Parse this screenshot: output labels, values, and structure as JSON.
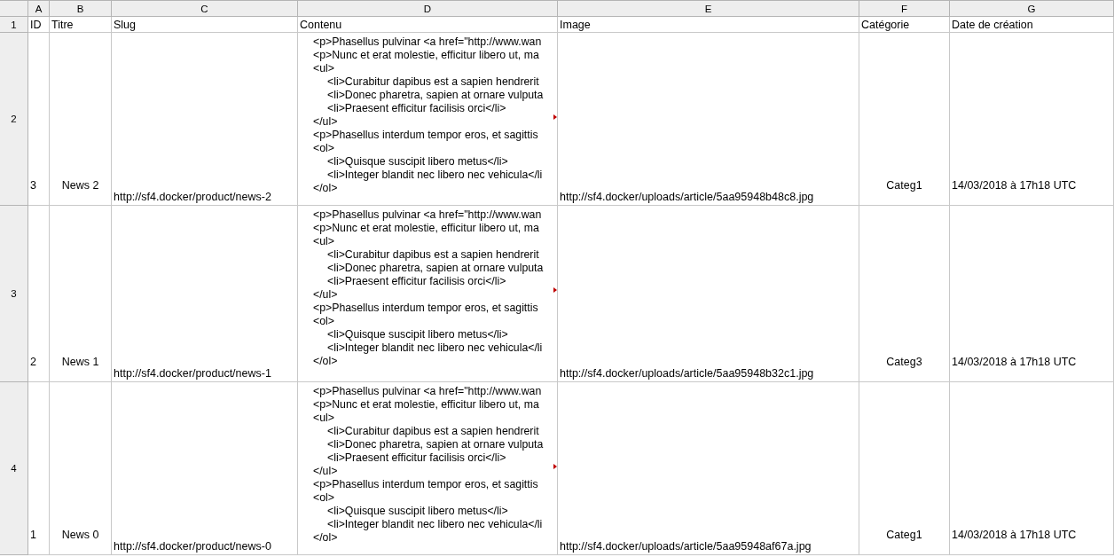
{
  "columns": [
    "A",
    "B",
    "C",
    "D",
    "E",
    "F",
    "G"
  ],
  "header_row": {
    "number": "1",
    "cells": [
      "ID",
      "Titre",
      "Slug",
      "Contenu",
      "Image",
      "Catégorie",
      "Date de création"
    ]
  },
  "rows": [
    {
      "number": "2",
      "id": "3",
      "title": "News 2",
      "slug": "http://sf4.docker/product/news-2",
      "content_truncated": true,
      "content": [
        {
          "kind": "outer",
          "text": "<p>Phasellus pulvinar <a href=\"http://www.wan"
        },
        {
          "kind": "outer",
          "text": "<p>Nunc et erat molestie, efficitur libero ut, ma"
        },
        {
          "kind": "outer",
          "text": "<ul>"
        },
        {
          "kind": "inner",
          "text": "<li>Curabitur dapibus est a sapien hendrerit"
        },
        {
          "kind": "inner",
          "text": "<li>Donec pharetra, sapien at ornare vulputa"
        },
        {
          "kind": "inner",
          "text": "<li>Praesent efficitur facilisis orci</li>"
        },
        {
          "kind": "outer",
          "text": "</ul>"
        },
        {
          "kind": "outer",
          "text": "<p>Phasellus interdum tempor eros, et sagittis"
        },
        {
          "kind": "outer",
          "text": "<ol>"
        },
        {
          "kind": "inner",
          "text": "<li>Quisque suscipit libero metus</li>"
        },
        {
          "kind": "inner",
          "text": "<li>Integer blandit nec libero nec vehicula</li"
        },
        {
          "kind": "outer",
          "text": "</ol>"
        }
      ],
      "image": "http://sf4.docker/uploads/article/5aa95948b48c8.jpg",
      "category": "Categ1",
      "date": "14/03/2018 à 17h18 UTC"
    },
    {
      "number": "3",
      "id": "2",
      "title": "News 1",
      "slug": "http://sf4.docker/product/news-1",
      "content_truncated": true,
      "content": [
        {
          "kind": "outer",
          "text": "<p>Phasellus pulvinar <a href=\"http://www.wan"
        },
        {
          "kind": "outer",
          "text": "<p>Nunc et erat molestie, efficitur libero ut, ma"
        },
        {
          "kind": "outer",
          "text": "<ul>"
        },
        {
          "kind": "inner",
          "text": "<li>Curabitur dapibus est a sapien hendrerit"
        },
        {
          "kind": "inner",
          "text": "<li>Donec pharetra, sapien at ornare vulputa"
        },
        {
          "kind": "inner",
          "text": "<li>Praesent efficitur facilisis orci</li>"
        },
        {
          "kind": "outer",
          "text": "</ul>"
        },
        {
          "kind": "outer",
          "text": "<p>Phasellus interdum tempor eros, et sagittis"
        },
        {
          "kind": "outer",
          "text": "<ol>"
        },
        {
          "kind": "inner",
          "text": "<li>Quisque suscipit libero metus</li>"
        },
        {
          "kind": "inner",
          "text": "<li>Integer blandit nec libero nec vehicula</li"
        },
        {
          "kind": "outer",
          "text": "</ol>"
        }
      ],
      "image": "http://sf4.docker/uploads/article/5aa95948b32c1.jpg",
      "category": "Categ3",
      "date": "14/03/2018 à 17h18 UTC"
    },
    {
      "number": "4",
      "id": "1",
      "title": "News 0",
      "slug": "http://sf4.docker/product/news-0",
      "content_truncated": true,
      "content": [
        {
          "kind": "outer",
          "text": "<p>Phasellus pulvinar <a href=\"http://www.wan"
        },
        {
          "kind": "outer",
          "text": "<p>Nunc et erat molestie, efficitur libero ut, ma"
        },
        {
          "kind": "outer",
          "text": "<ul>"
        },
        {
          "kind": "inner",
          "text": "<li>Curabitur dapibus est a sapien hendrerit"
        },
        {
          "kind": "inner",
          "text": "<li>Donec pharetra, sapien at ornare vulputa"
        },
        {
          "kind": "inner",
          "text": "<li>Praesent efficitur facilisis orci</li>"
        },
        {
          "kind": "outer",
          "text": "</ul>"
        },
        {
          "kind": "outer",
          "text": "<p>Phasellus interdum tempor eros, et sagittis"
        },
        {
          "kind": "outer",
          "text": "<ol>"
        },
        {
          "kind": "inner",
          "text": "<li>Quisque suscipit libero metus</li>"
        },
        {
          "kind": "inner",
          "text": "<li>Integer blandit nec libero nec vehicula</li"
        },
        {
          "kind": "outer",
          "text": "</ol>"
        }
      ],
      "image": "http://sf4.docker/uploads/article/5aa95948af67a.jpg",
      "category": "Categ1",
      "date": "14/03/2018 à 17h18 UTC"
    }
  ]
}
